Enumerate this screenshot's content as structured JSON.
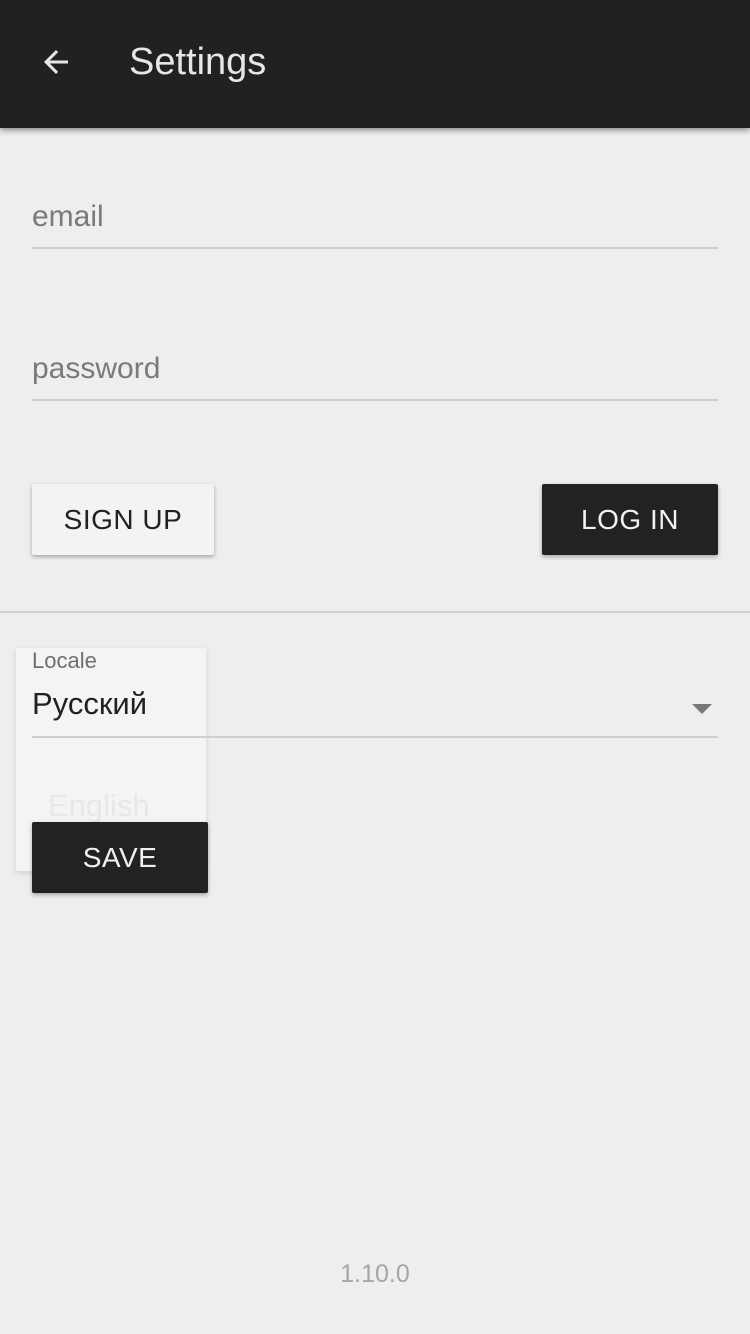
{
  "appbar": {
    "title": "Settings",
    "back_icon": "arrow-back-icon",
    "background": "#212121"
  },
  "login_form": {
    "email_placeholder": "email",
    "password_placeholder": "password",
    "signup_label": "SIGN UP",
    "login_label": "LOG IN"
  },
  "locale": {
    "label": "Locale",
    "selected": "Русский",
    "menu_option": "English",
    "arrow_icon": "dropdown-arrow-icon"
  },
  "save_label": "SAVE",
  "version": "1.10.0"
}
